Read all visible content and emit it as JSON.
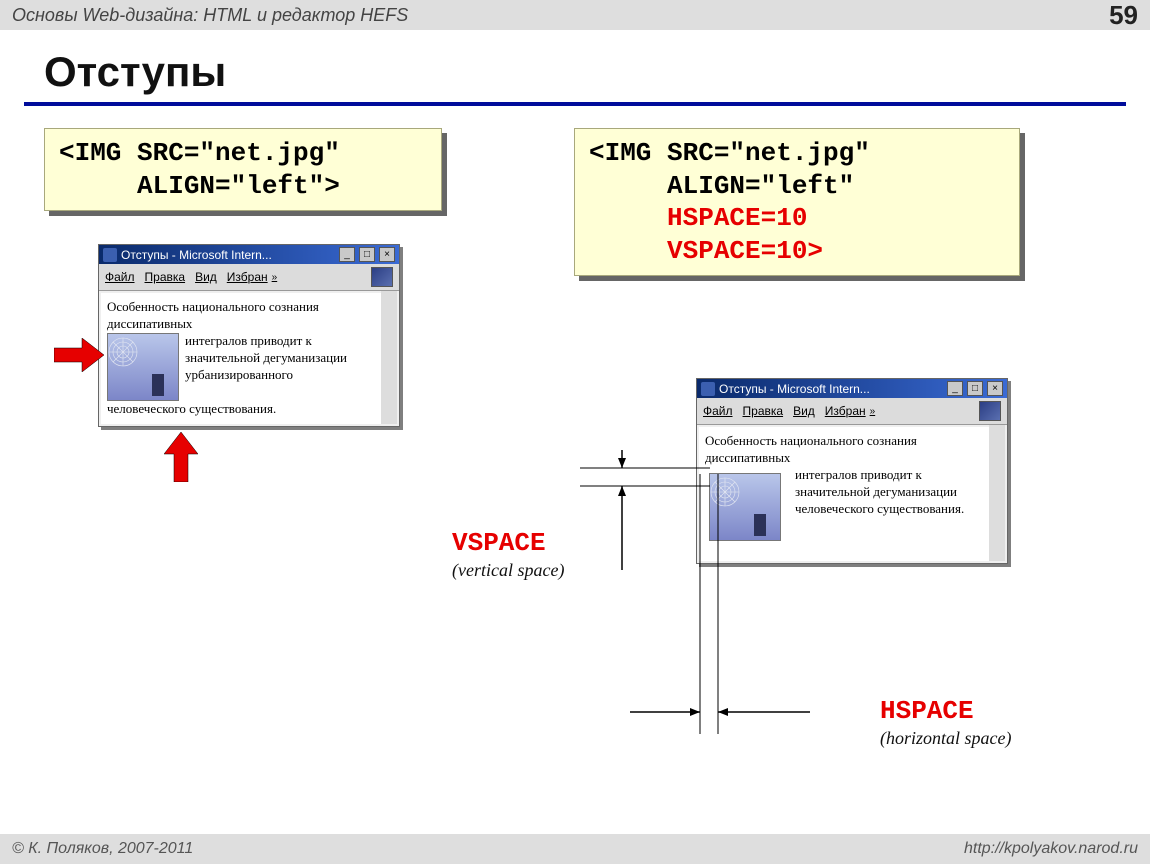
{
  "topbar": {
    "title": "Основы Web-дизайна: HTML и редактор HEFS",
    "page": "59"
  },
  "title": "Отступы",
  "code_left": {
    "line1": "<IMG SRC=\"net.jpg\"",
    "line2": "     ALIGN=\"left\">"
  },
  "code_right": {
    "line1": "<IMG SRC=\"net.jpg\"",
    "line2": "     ALIGN=\"left\"",
    "line3": "     HSPACE=10",
    "line4": "     VSPACE=10>"
  },
  "browser": {
    "title": "Отступы - Microsoft Intern...",
    "menu": {
      "file": "Файл",
      "edit": "Правка",
      "view": "Вид",
      "fav": "Избран",
      "chev": "»"
    },
    "text_full": "Особенность национального сознания диссипативных интегралов приводит к значительной дегуманизации урбанизированного человеческого существования.",
    "text_top": "Особенность национального сознания диссипативных",
    "text_side": "интегралов приводит к значительной дегуманизации урбанизированного",
    "text_bottom": "человеческого существования."
  },
  "browser2": {
    "text_top": "Особенность национального сознания диссипативных",
    "text_side": "интегралов приводит к значительной дегуманизации человеческого существования."
  },
  "annot": {
    "vspace": "VSPACE",
    "vspace_sub": "(vertical space)",
    "hspace": "HSPACE",
    "hspace_sub": "(horizontal space)"
  },
  "footer": {
    "copyright": "© К. Поляков, 2007-2011",
    "url": "http://kpolyakov.narod.ru"
  }
}
